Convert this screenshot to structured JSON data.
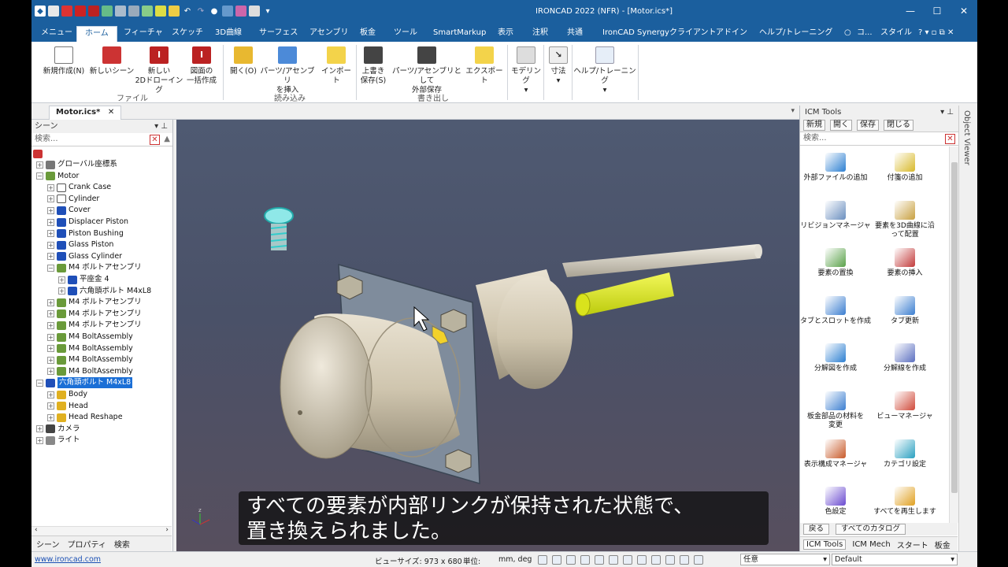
{
  "window": {
    "title": "IRONCAD 2022 (NFR) - [Motor.ics*]"
  },
  "menu_tabs": [
    "メニュー",
    "ホーム",
    "フィーチャ",
    "スケッチ",
    "3D曲線",
    "サーフェス",
    "アセンブリ",
    "板金",
    "ツール",
    "SmartMarkup",
    "表示",
    "注釈",
    "共通",
    "IronCAD Synergyクライアント",
    "アドイン",
    "ヘルプ/トレーニング"
  ],
  "menu_right": {
    "user": "コ...",
    "style": "スタイル"
  },
  "ribbon": {
    "buttons": [
      {
        "label": "新規作成(N)"
      },
      {
        "label": "新しいシーン"
      },
      {
        "label": "新しい\n2Dドローイング"
      },
      {
        "label": "図面の\n一括作成"
      },
      {
        "label": "開く(O)"
      },
      {
        "label": "パーツ/アセンブリ\nを挿入"
      },
      {
        "label": "インポート"
      },
      {
        "label": "上書き\n保存(S)"
      },
      {
        "label": "パーツ/アセンブリとして\n外部保存"
      },
      {
        "label": "エクスポート"
      },
      {
        "label": "モデリング"
      },
      {
        "label": "寸法"
      },
      {
        "label": "ヘルプ/トレーニング"
      }
    ],
    "groups": [
      "ファイル",
      "読み込み",
      "書き出し"
    ]
  },
  "document_tab": "Motor.ics*",
  "scene_panel": {
    "title": "シーン",
    "search_placeholder": "検索...",
    "tree": [
      {
        "label": "グローバル座標系",
        "level": 1,
        "icon": "axis"
      },
      {
        "label": "Motor",
        "level": 1,
        "icon": "asm"
      },
      {
        "label": "Crank Case",
        "level": 2,
        "icon": "sketch"
      },
      {
        "label": "Cylinder",
        "level": 2,
        "icon": "sketch"
      },
      {
        "label": "Cover",
        "level": 2,
        "icon": "part"
      },
      {
        "label": "Displacer Piston",
        "level": 2,
        "icon": "part"
      },
      {
        "label": "Piston Bushing",
        "level": 2,
        "icon": "part"
      },
      {
        "label": "Glass Piston",
        "level": 2,
        "icon": "part"
      },
      {
        "label": "Glass Cylinder",
        "level": 2,
        "icon": "part"
      },
      {
        "label": "M4 ボルトアセンブリ",
        "level": 2,
        "icon": "asm"
      },
      {
        "label": "平座金 4",
        "level": 3,
        "icon": "part"
      },
      {
        "label": "六角頭ボルト M4xL8",
        "level": 3,
        "icon": "part"
      },
      {
        "label": "M4 ボルトアセンブリ",
        "level": 2,
        "icon": "asm"
      },
      {
        "label": "M4 ボルトアセンブリ",
        "level": 2,
        "icon": "asm"
      },
      {
        "label": "M4 ボルトアセンブリ",
        "level": 2,
        "icon": "asm"
      },
      {
        "label": "M4 BoltAssembly",
        "level": 2,
        "icon": "asm"
      },
      {
        "label": "M4 BoltAssembly",
        "level": 2,
        "icon": "asm"
      },
      {
        "label": "M4 BoltAssembly",
        "level": 2,
        "icon": "asm"
      },
      {
        "label": "M4 BoltAssembly",
        "level": 2,
        "icon": "asm"
      },
      {
        "label": "六角頭ボルト M4xL8",
        "level": 1,
        "icon": "part",
        "selected": true
      },
      {
        "label": "Body",
        "level": 2,
        "icon": "feature"
      },
      {
        "label": "Head",
        "level": 2,
        "icon": "feature"
      },
      {
        "label": "Head Reshape",
        "level": 2,
        "icon": "feature"
      },
      {
        "label": "カメラ",
        "level": 1,
        "icon": "camera"
      },
      {
        "label": "ライト",
        "level": 1,
        "icon": "light"
      }
    ],
    "bottom_tabs": [
      "シーン",
      "プロパティ",
      "検索"
    ]
  },
  "viewport": {
    "subtitle_line1": "すべての要素が内部リンクが保持された状態で、",
    "subtitle_line2": "置き換えられました。"
  },
  "icm_panel": {
    "title": "ICM Tools",
    "toolbar": [
      "新規",
      "開く",
      "保存",
      "閉じる"
    ],
    "search_placeholder": "検索...",
    "items": [
      {
        "label": "外部ファイルの追加"
      },
      {
        "label": "付箋の追加"
      },
      {
        "label": "リビジョンマネージャ"
      },
      {
        "label": "要素を3D曲線に沿\nって配置"
      },
      {
        "label": "要素の置換"
      },
      {
        "label": "要素の挿入"
      },
      {
        "label": "タブとスロットを作成"
      },
      {
        "label": "タブ更新"
      },
      {
        "label": "分解図を作成"
      },
      {
        "label": "分解線を作成"
      },
      {
        "label": "板金部品の材料を\n変更"
      },
      {
        "label": "ビューマネージャ"
      },
      {
        "label": "表示構成マネージャ"
      },
      {
        "label": "カテゴリ設定"
      },
      {
        "label": "色設定"
      },
      {
        "label": "すべてを再生します"
      }
    ],
    "nav": [
      "戻る",
      "すべてのカタログ"
    ],
    "bottom_tabs": [
      "ICM Tools",
      "ICM Mech",
      "スタート",
      "板金"
    ]
  },
  "object_viewer_label": "Object Viewer",
  "status": {
    "link": "www.ironcad.com",
    "view_size": "ビューサイズ: 973 x 680",
    "unit_label": "単位:",
    "unit_value": "mm, deg",
    "select_mode": "任意",
    "style_value": "Default"
  },
  "colors": {
    "accent": "#1b5f9e",
    "highlight": "#e4f21a",
    "selection": "#1b6fd6"
  }
}
